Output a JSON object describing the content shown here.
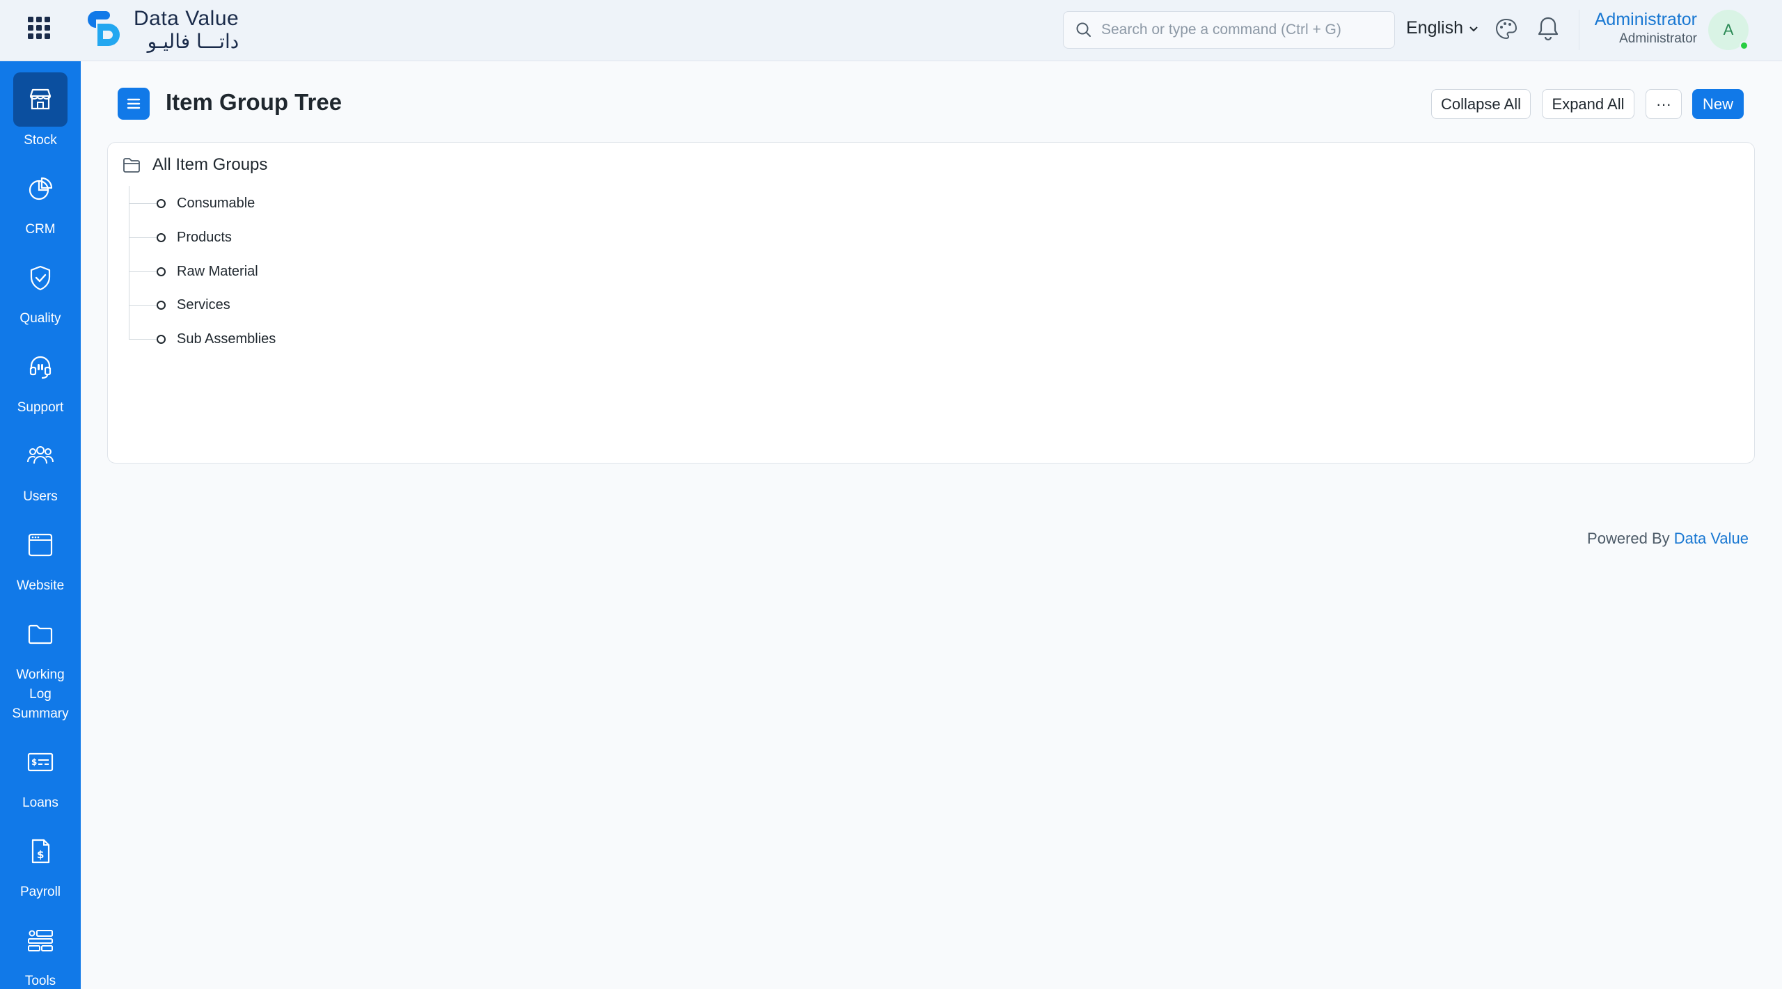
{
  "brand": {
    "name_en": "Data Value",
    "name_ar": "داتـــا فاليـو",
    "primary_color": "#1179e8"
  },
  "search": {
    "placeholder": "Search or type a command (Ctrl + G)"
  },
  "language": {
    "selected": "English"
  },
  "user": {
    "name": "Administrator",
    "role": "Administrator",
    "avatar_initial": "A",
    "status_color": "#29cd42"
  },
  "sidebar": {
    "items": [
      {
        "label": "Stock",
        "icon": "store-icon",
        "active": true
      },
      {
        "label": "CRM",
        "icon": "pie-chart-icon",
        "active": false
      },
      {
        "label": "Quality",
        "icon": "shield-check-icon",
        "active": false
      },
      {
        "label": "Support",
        "icon": "headset-icon",
        "active": false
      },
      {
        "label": "Users",
        "icon": "users-icon",
        "active": false
      },
      {
        "label": "Website",
        "icon": "browser-icon",
        "active": false
      },
      {
        "label": "Working Log Summary",
        "icon": "folder-icon",
        "active": false
      },
      {
        "label": "Loans",
        "icon": "money-card-icon",
        "active": false
      },
      {
        "label": "Payroll",
        "icon": "payroll-document-icon",
        "active": false
      },
      {
        "label": "Tools",
        "icon": "tools-icon",
        "active": false
      }
    ]
  },
  "page": {
    "title": "Item Group Tree",
    "buttons": {
      "collapse_all": "Collapse All",
      "expand_all": "Expand All",
      "more": "···",
      "new": "New"
    }
  },
  "tree": {
    "root_label": "All Item Groups",
    "children": [
      "Consumable",
      "Products",
      "Raw Material",
      "Services",
      "Sub Assemblies"
    ]
  },
  "footer": {
    "powered_by": "Powered By",
    "powered_link": "Data Value"
  }
}
